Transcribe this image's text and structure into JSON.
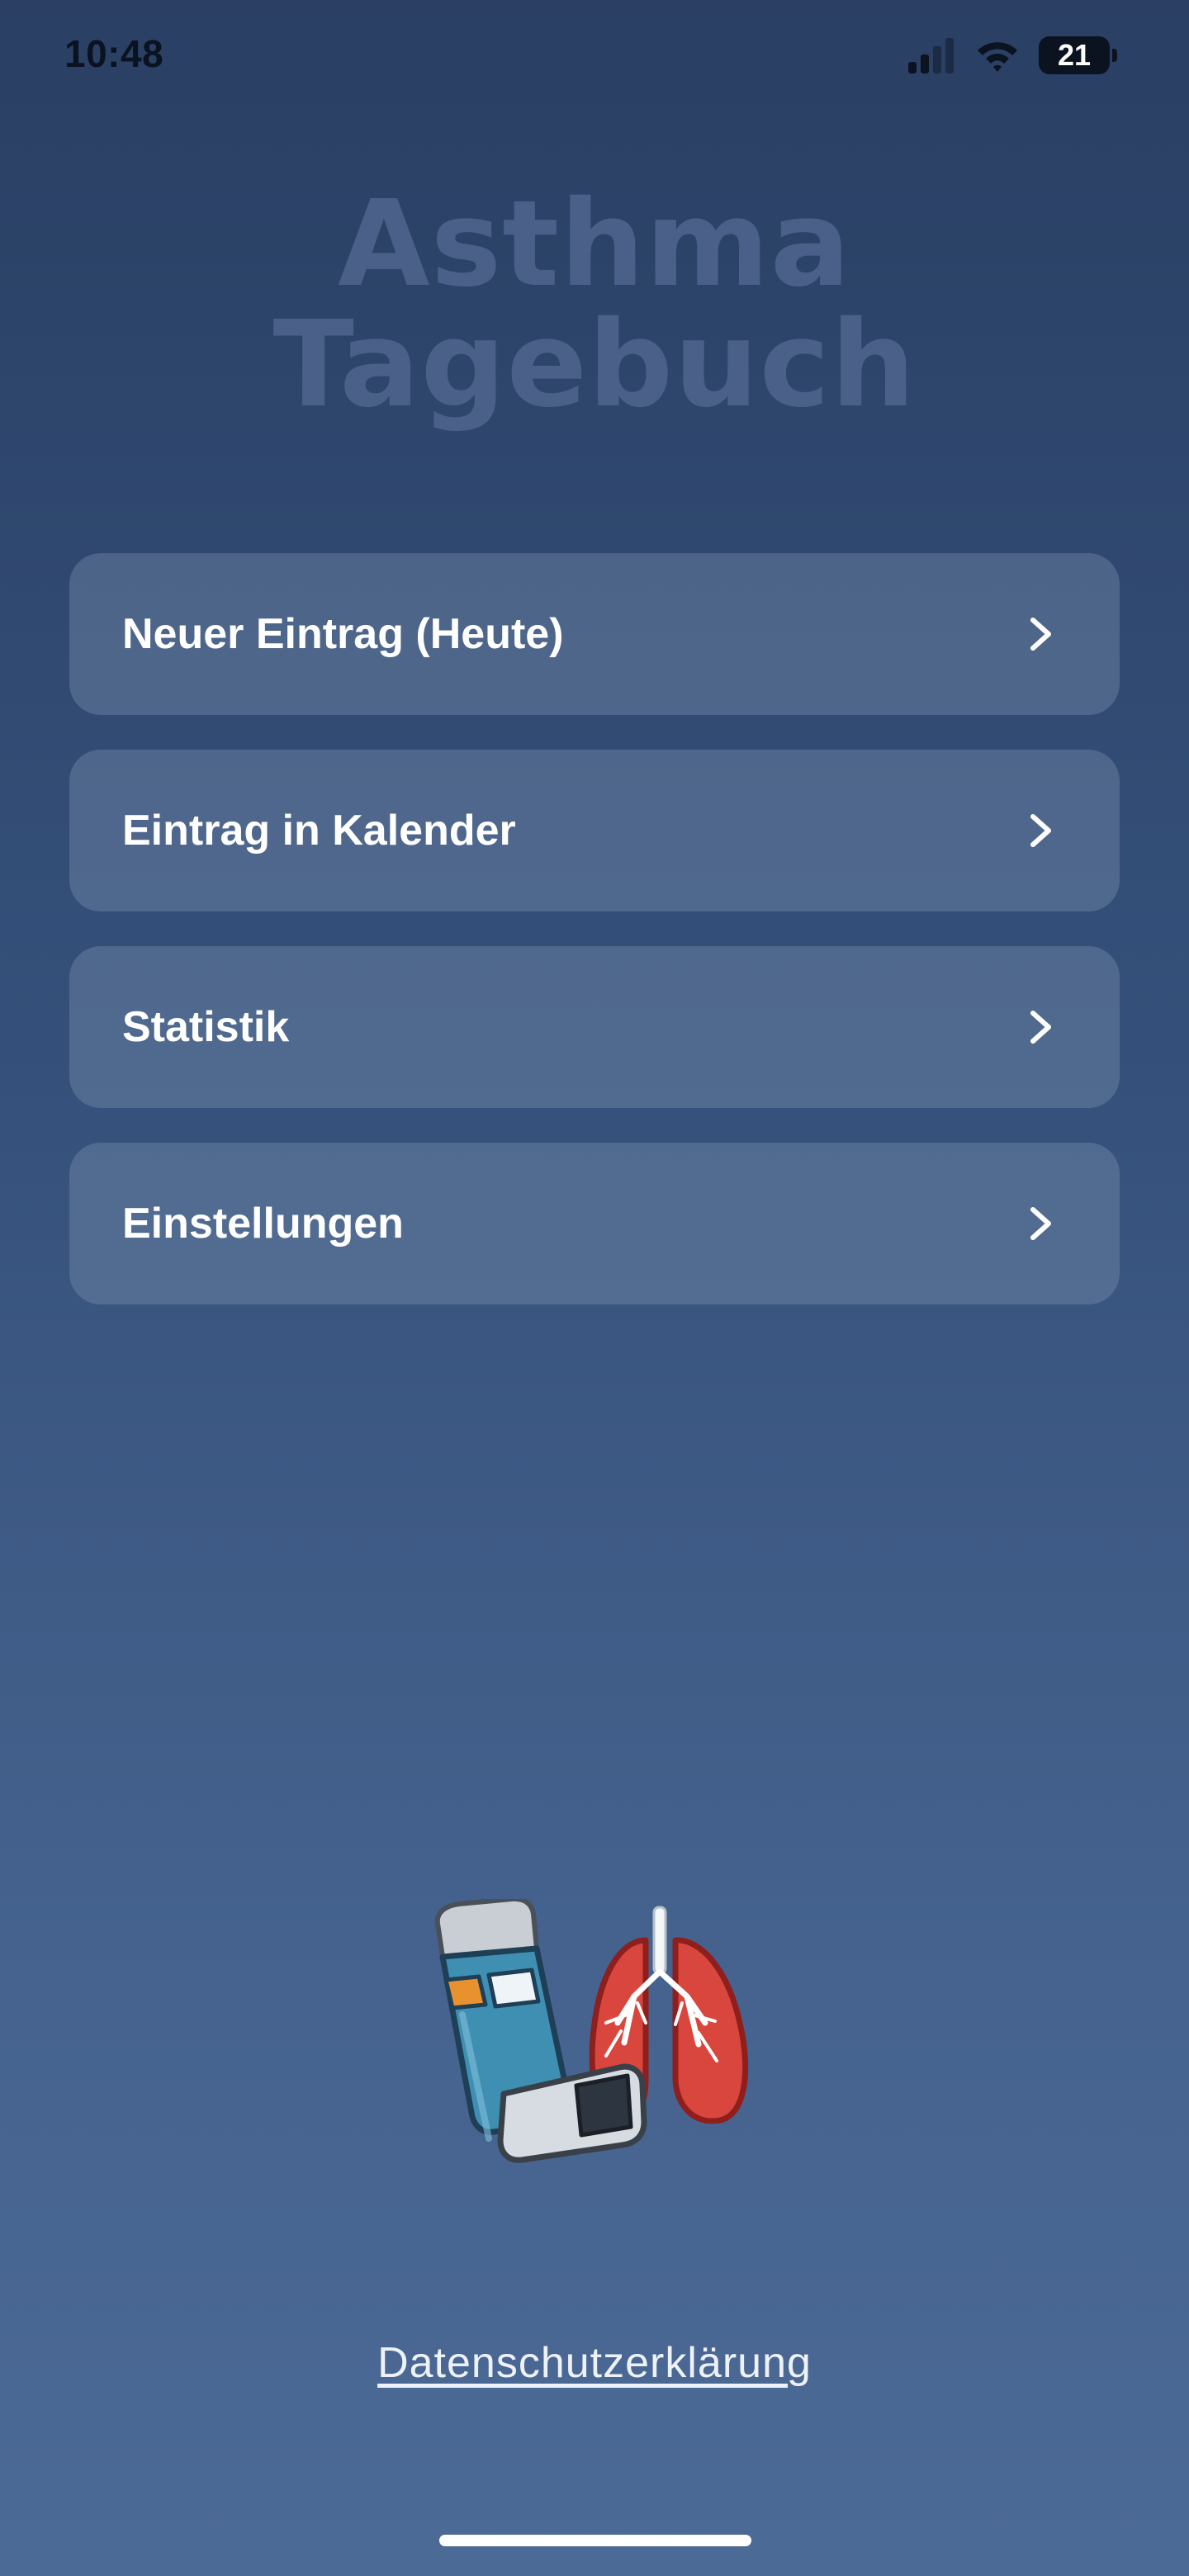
{
  "status_bar": {
    "time": "10:48",
    "battery_level": "21",
    "icons": [
      "signal-icon",
      "wifi-icon",
      "battery-icon"
    ]
  },
  "header": {
    "title_line1": "Asthma",
    "title_line2": "Tagebuch"
  },
  "menu": {
    "items": [
      {
        "label": "Neuer Eintrag (Heute)",
        "icon": "chevron-right-icon"
      },
      {
        "label": "Eintrag in Kalender",
        "icon": "chevron-right-icon"
      },
      {
        "label": "Statistik",
        "icon": "chevron-right-icon"
      },
      {
        "label": "Einstellungen",
        "icon": "chevron-right-icon"
      }
    ]
  },
  "illustration": {
    "icon": "inhaler-lungs-icon"
  },
  "footer": {
    "privacy_label": "Datenschutzerklärung"
  },
  "colors": {
    "background_top": "#2a3f63",
    "background_bottom": "#4c6a96",
    "title": "#4a6088",
    "menu_item_bg": "#5a6f93",
    "text": "#ffffff",
    "inhaler": "#3f8fb3",
    "lungs": "#d9463e"
  }
}
